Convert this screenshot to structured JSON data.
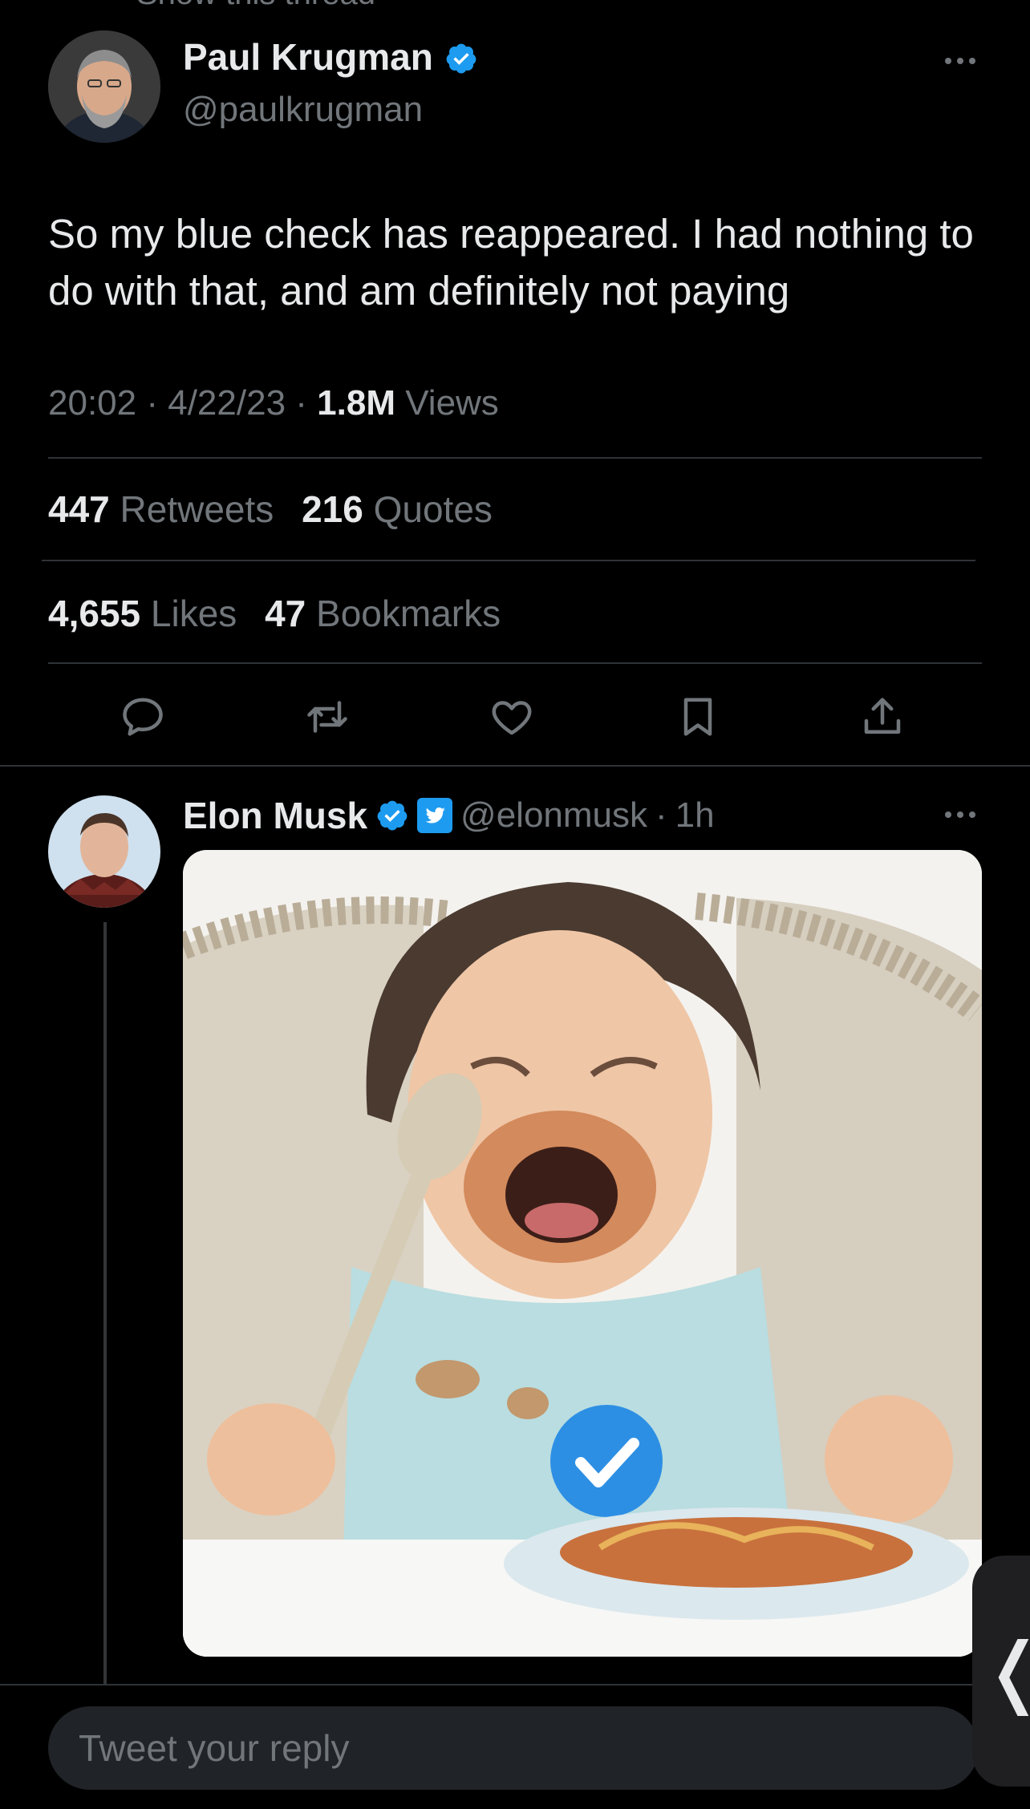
{
  "top_cut_text": "Show this thread",
  "main_tweet": {
    "author_name": "Paul Krugman",
    "author_handle": "@paulkrugman",
    "text": "So my blue check has reappeared. I had nothing to do with that, and am definitely not paying",
    "time": "20:02",
    "date": "4/22/23",
    "views_count": "1.8M",
    "views_label": "Views",
    "retweets_count": "447",
    "retweets_label": "Retweets",
    "quotes_count": "216",
    "quotes_label": "Quotes",
    "likes_count": "4,655",
    "likes_label": "Likes",
    "bookmarks_count": "47",
    "bookmarks_label": "Bookmarks"
  },
  "reply_tweet": {
    "author_name": "Elon Musk",
    "author_handle": "@elonmusk",
    "time_ago": "1h"
  },
  "composer": {
    "placeholder": "Tweet your reply"
  },
  "side_handle_glyph": "❬",
  "icons": {
    "verified": "verified-badge-icon",
    "twitter_bird": "twitter-bird-icon",
    "actions": [
      "reply-icon",
      "retweet-icon",
      "like-icon",
      "bookmark-icon",
      "share-icon"
    ]
  },
  "colors": {
    "background": "#000000",
    "text_primary": "#e7e9ea",
    "text_secondary": "#71767b",
    "accent": "#1d9bf0",
    "divider": "#2f3336"
  }
}
